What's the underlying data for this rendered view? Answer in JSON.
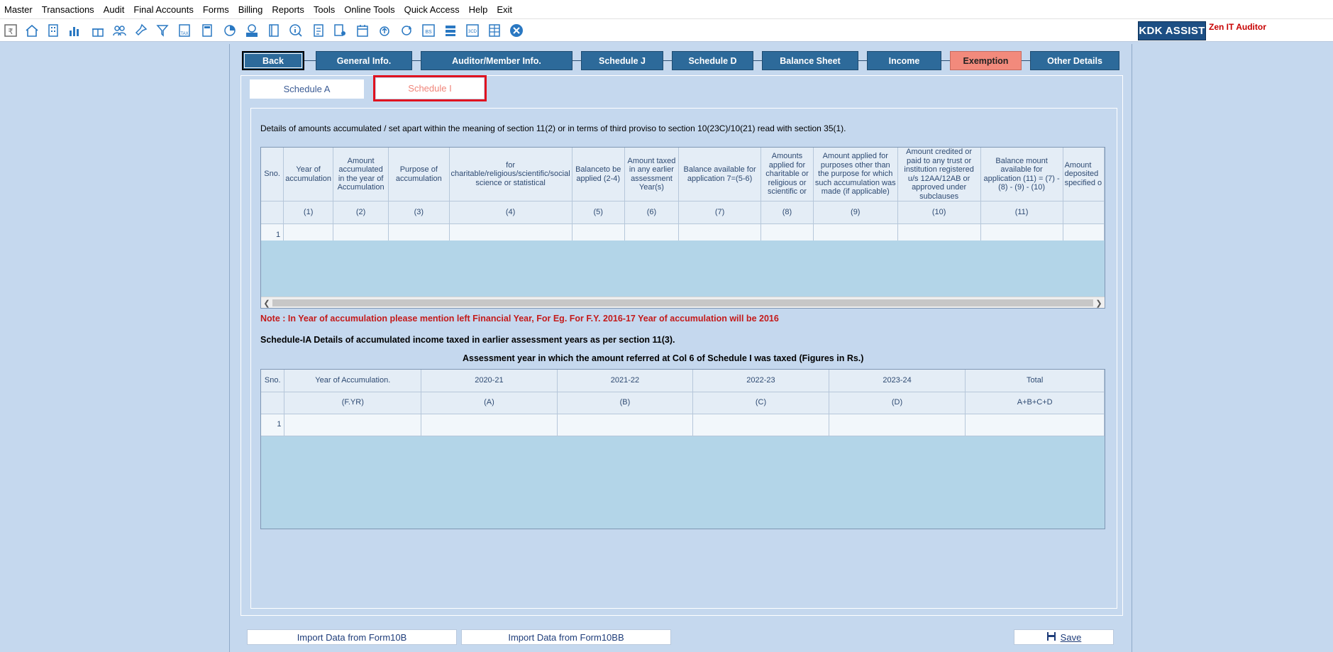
{
  "menu": [
    "Master",
    "Transactions",
    "Audit",
    "Final Accounts",
    "Forms",
    "Billing",
    "Reports",
    "Tools",
    "Online Tools",
    "Quick Access",
    "Help",
    "Exit"
  ],
  "toolbar": {
    "kdk_assist": "KDK ASSIST",
    "app_name": "Zen IT Auditor",
    "icons": [
      "rupee-icon",
      "home-icon",
      "building-icon",
      "bar-chart-icon",
      "gift-icon",
      "users-icon",
      "pin-icon",
      "filter-icon",
      "tax-icon",
      "calculator-icon",
      "pie-chart-icon",
      "pay-icon",
      "book-icon",
      "info-icon",
      "form-icon",
      "person-form-icon",
      "calendar-icon",
      "upload-icon",
      "refresh-icon",
      "bs-icon",
      "stack-icon",
      "3cd-icon",
      "grid-icon",
      "close-icon"
    ]
  },
  "nav": {
    "back": "Back",
    "general_info": "General Info.",
    "auditor_info": "Auditor/Member Info.",
    "schedule_j": "Schedule J",
    "schedule_d": "Schedule D",
    "balance_sheet": "Balance Sheet",
    "income": "Income",
    "exemption": "Exemption",
    "other_details": "Other Details"
  },
  "tabs": {
    "schedule_a": "Schedule A",
    "schedule_i": "Schedule I"
  },
  "schedule_i": {
    "description": "Details of amounts accumulated / set apart within the meaning of section 11(2) or in terms of third proviso to section 10(23C)/10(21) read with section 35(1).",
    "headers": [
      "Sno.",
      "Year of accumulation",
      "Amount accumulated in the year of Accumulation",
      "Purpose of accumulation",
      "for charitable/religious/scientific/social science or statistical",
      "Balanceto be applied (2-4)",
      "Amount taxed in any earlier assessment Year(s)",
      "Balance available for application      7=(5-6)",
      "Amounts applied for charitable or religious or scientific or",
      "Amount applied for purposes other than the purpose for which such accumulation was made (if  applicable)",
      "Amount credited or paid to any trust or institution registered u/s 12AA/12AB or approved under subclauses",
      "Balance mount available for application (11) = (7) - (8) - (9) - (10)",
      "Amount deposited specified o"
    ],
    "col_numbers": [
      "",
      "(1)",
      "(2)",
      "(3)",
      "(4)",
      "(5)",
      "(6)",
      "(7)",
      "(8)",
      "(9)",
      "(10)",
      "(11)",
      ""
    ],
    "rows": [
      [
        "1",
        "",
        "",
        "",
        "",
        "",
        "",
        "",
        "",
        "",
        "",
        "",
        ""
      ]
    ]
  },
  "note": "Note : In Year of accumulation please mention left Financial Year, For Eg. For F.Y. 2016-17  Year of accumulation will be 2016",
  "schedule_ia": {
    "title": "Schedule-IA Details of accumulated income taxed in earlier assessment years as per section 11(3).",
    "subtitle": "Assessment year in which the amount referred at Col 6 of Schedule I was taxed (Figures in Rs.)",
    "headers": [
      "Sno.",
      "Year of Accumulation.",
      "2020-21",
      "2021-22",
      "2022-23",
      "2023-24",
      "Total"
    ],
    "col_codes": [
      "",
      "(F.YR)",
      "(A)",
      "(B)",
      "(C)",
      "(D)",
      "A+B+C+D"
    ],
    "rows": [
      [
        "1",
        "",
        "",
        "",
        "",
        "",
        ""
      ]
    ]
  },
  "buttons": {
    "import_10b": "Import Data from Form10B",
    "import_10bb": "Import Data from Form10BB",
    "save": "Save"
  }
}
